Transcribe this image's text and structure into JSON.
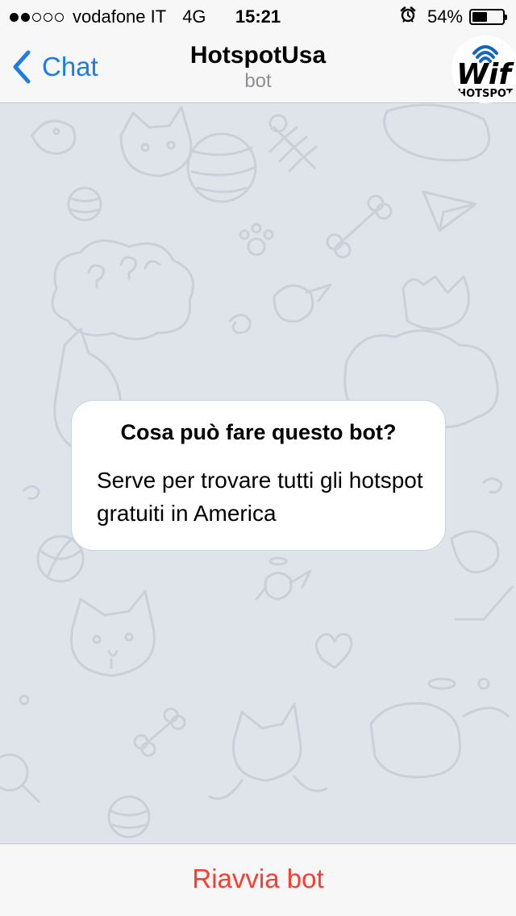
{
  "status_bar": {
    "signal": {
      "filled": 2,
      "total": 5
    },
    "carrier": "vodafone IT",
    "network": "4G",
    "time": "15:21",
    "alarm_icon": "alarm-clock-icon",
    "battery_percent": "54%",
    "battery_level": 0.54
  },
  "nav": {
    "back_label": "Chat",
    "back_icon": "chevron-left-icon",
    "title": "HotspotUsa",
    "subtitle": "bot",
    "avatar_text_top": "Wif",
    "avatar_text_bottom": "HOTSPOT",
    "accent_color": "#1f7ce6"
  },
  "bot_info": {
    "title": "Cosa può fare questo bot?",
    "description": "Serve per trovare tutti gli hotspot gratuiti in America"
  },
  "bottom": {
    "restart_label": "Riavvia bot",
    "restart_color": "#ff3b30"
  },
  "chat_background_color": "#dfe3ea"
}
